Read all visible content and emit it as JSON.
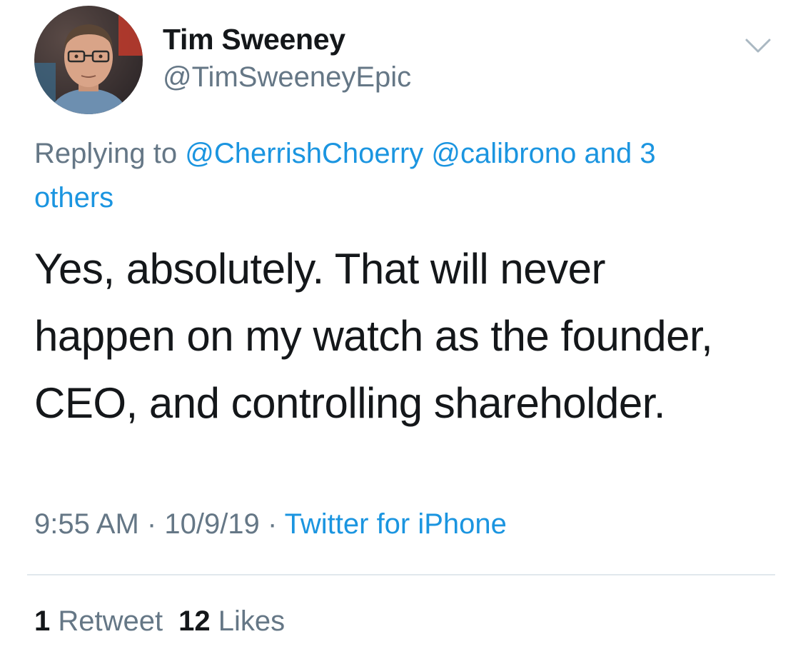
{
  "tweet": {
    "author": {
      "display_name": "Tim Sweeney",
      "handle": "@TimSweeneyEpic",
      "avatar_icon": "profile-photo"
    },
    "menu_icon": "chevron-down-icon",
    "reply": {
      "prefix": "Replying to",
      "mentions": [
        "@CherrishChoerry",
        "@calibrono"
      ],
      "and_text": "and",
      "others_count": "3",
      "others_label": "others"
    },
    "text_lines": [
      "Yes, absolutely. That will never",
      "happen on my watch as the founder,",
      "CEO, and controlling shareholder."
    ],
    "meta": {
      "time": "9:55 AM",
      "separator": "·",
      "date": "10/9/19",
      "source": "Twitter for iPhone"
    },
    "stats": {
      "retweets_count": "1",
      "retweets_label": "Retweet",
      "likes_count": "12",
      "likes_label": "Likes"
    }
  },
  "colors": {
    "link": "#1b95e0",
    "secondary": "#657786",
    "primary": "#14171a",
    "divider": "#e1e8ed"
  }
}
